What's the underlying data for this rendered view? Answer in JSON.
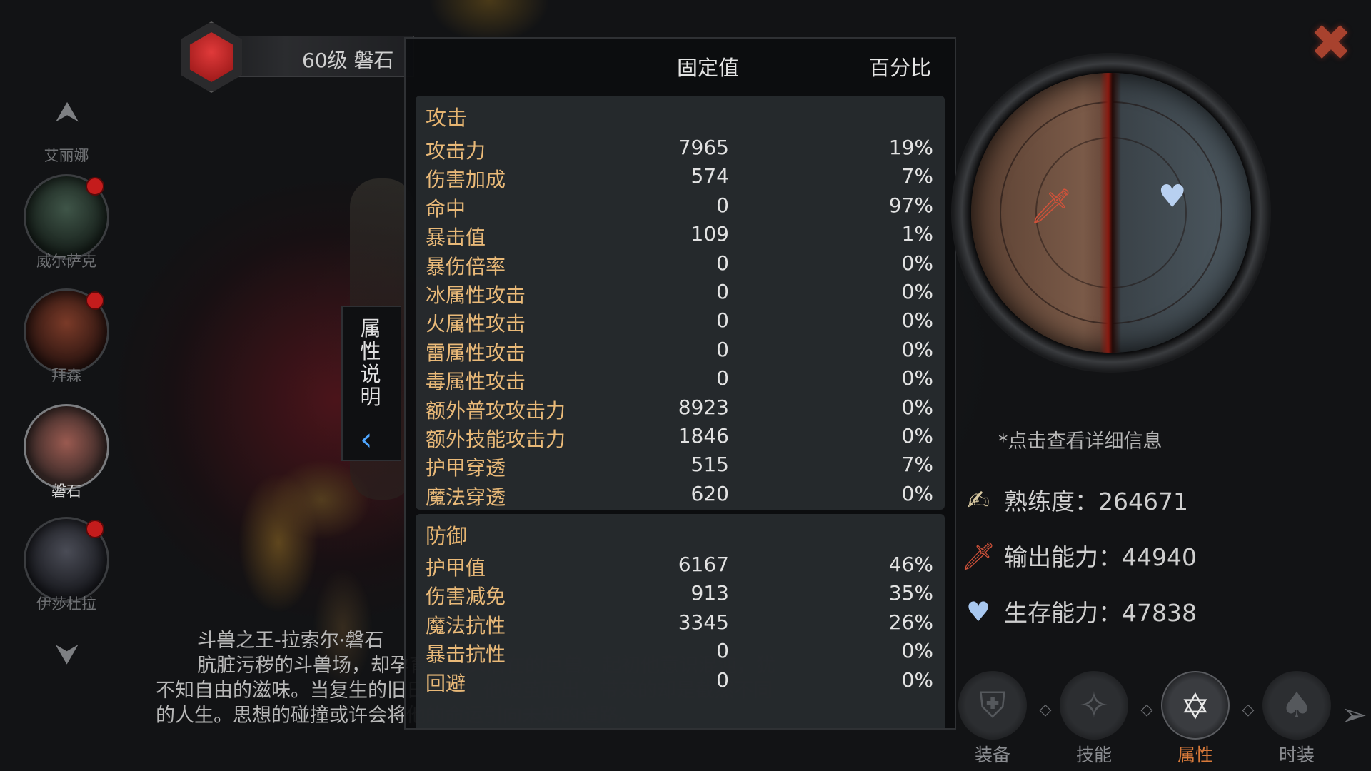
{
  "hero": {
    "title": "60级 磐石"
  },
  "hero_list": [
    {
      "name": "艾丽娜",
      "has_notice": false,
      "active": false
    },
    {
      "name": "威尔萨克",
      "has_notice": true,
      "active": false
    },
    {
      "name": "拜森",
      "has_notice": true,
      "active": false
    },
    {
      "name": "磐石",
      "has_notice": false,
      "active": true
    },
    {
      "name": "伊莎杜拉",
      "has_notice": true,
      "active": false
    }
  ],
  "side_tab": {
    "label": "属性说明"
  },
  "stats": {
    "col_fixed": "固定值",
    "col_percent": "百分比",
    "attack": {
      "title": "攻击",
      "rows": [
        {
          "name": "攻击力",
          "value": "7965",
          "percent": "19%"
        },
        {
          "name": "伤害加成",
          "value": "574",
          "percent": "7%"
        },
        {
          "name": "命中",
          "value": "0",
          "percent": "97%"
        },
        {
          "name": "暴击值",
          "value": "109",
          "percent": "1%"
        },
        {
          "name": "暴伤倍率",
          "value": "0",
          "percent": "0%"
        },
        {
          "name": "冰属性攻击",
          "value": "0",
          "percent": "0%"
        },
        {
          "name": "火属性攻击",
          "value": "0",
          "percent": "0%"
        },
        {
          "name": "雷属性攻击",
          "value": "0",
          "percent": "0%"
        },
        {
          "name": "毒属性攻击",
          "value": "0",
          "percent": "0%"
        },
        {
          "name": "额外普攻攻击力",
          "value": "8923",
          "percent": "0%"
        },
        {
          "name": "额外技能攻击力",
          "value": "1846",
          "percent": "0%"
        },
        {
          "name": "护甲穿透",
          "value": "515",
          "percent": "7%"
        },
        {
          "name": "魔法穿透",
          "value": "620",
          "percent": "0%"
        }
      ]
    },
    "defense": {
      "title": "防御",
      "rows": [
        {
          "name": "护甲值",
          "value": "6167",
          "percent": "46%"
        },
        {
          "name": "伤害减免",
          "value": "913",
          "percent": "35%"
        },
        {
          "name": "魔法抗性",
          "value": "3345",
          "percent": "26%"
        },
        {
          "name": "暴击抗性",
          "value": "0",
          "percent": "0%"
        },
        {
          "name": "回避",
          "value": "0",
          "percent": "0%"
        }
      ]
    }
  },
  "description": {
    "line1": "斗兽之王-拉索尔·磐石",
    "line2": "肮脏污秽的斗兽场，却孕育了一头潜在的巨兽。起初他意识混沌，犹",
    "line3": "不知自由的滋味。当复生的旧日降临，他破茧而出，带来的却是截然不同",
    "line4": "的人生。思想的碰撞或许会将他的命运引向未知的道路。"
  },
  "rune": {
    "hint": "*点击查看详细信息"
  },
  "metrics": {
    "proficiency": "熟练度：264671",
    "output": "输出能力：44940",
    "survival": "生存能力：47838"
  },
  "tabs": {
    "equip": "装备",
    "skill": "技能",
    "attr": "属性",
    "fashion": "时装"
  },
  "icons": {
    "close": "close-x-icon",
    "up": "arrow-up-icon",
    "down": "arrow-down-icon",
    "sword": "sword-icon",
    "heart": "heart-icon",
    "proficiency": "proficiency-icon"
  },
  "colors": {
    "stat_label": "#e9b978",
    "section_title": "#e6b470",
    "active_tab": "#d87a3a",
    "notice_dot": "#c41c1c"
  }
}
